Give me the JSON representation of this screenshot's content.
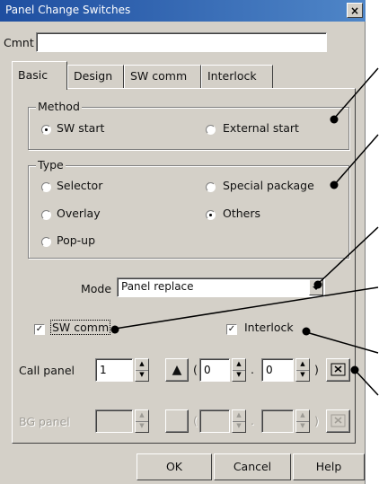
{
  "window": {
    "title": "Panel Change Switches",
    "close_label": "×"
  },
  "comment": {
    "label": "Cmnt",
    "value": ""
  },
  "tabs": [
    {
      "label": "Basic",
      "active": true
    },
    {
      "label": "Design",
      "active": false
    },
    {
      "label": "SW comm",
      "active": false
    },
    {
      "label": "Interlock",
      "active": false
    }
  ],
  "method": {
    "title": "Method",
    "options": [
      {
        "label": "SW start",
        "selected": true
      },
      {
        "label": "External start",
        "selected": false
      }
    ]
  },
  "type": {
    "title": "Type",
    "options": [
      {
        "label": "Selector",
        "selected": false
      },
      {
        "label": "Special package",
        "selected": false
      },
      {
        "label": "Overlay",
        "selected": false
      },
      {
        "label": "Others",
        "selected": true
      },
      {
        "label": "Pop-up",
        "selected": false
      }
    ]
  },
  "mode": {
    "label": "Mode",
    "value": "Panel replace"
  },
  "sw_comm": {
    "label": "SW comm",
    "checked": true
  },
  "interlock": {
    "label": "Interlock",
    "checked": true
  },
  "call_panel": {
    "label": "Call panel",
    "value": "1",
    "paren_open": "(",
    "x": "0",
    "separator": ".",
    "y": "0",
    "paren_close": ")"
  },
  "bg_panel": {
    "label": "BG panel",
    "value": "",
    "paren_open": "(",
    "x": "",
    "separator": ".",
    "y": "",
    "paren_close": ")"
  },
  "buttons": {
    "ok": "OK",
    "cancel": "Cancel",
    "help": "Help"
  },
  "icons": {
    "close": "close-icon",
    "spin": "spin-updown-icon",
    "triangle": "triangle-up-icon",
    "coord_picker": "coordinate-picker-icon",
    "dropdown": "chevron-down-icon"
  },
  "colors": {
    "title_bar": "#1e4ea0",
    "dialog_bg": "#d4d0c8"
  }
}
